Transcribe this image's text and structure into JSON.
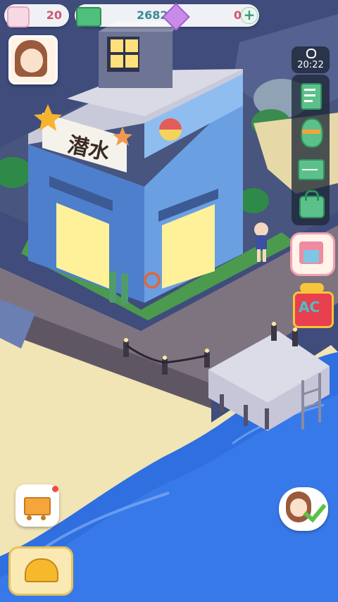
{
  "hud": {
    "gems_value": "20",
    "cash_value": "2682",
    "crystal_value": "0",
    "plus_symbol": "+",
    "clock_time": "20:22"
  },
  "building": {
    "sign_text": "潜水"
  },
  "side_menu": {
    "items": [
      "task-list",
      "easter-egg",
      "mail",
      "bag"
    ]
  },
  "action_buttons": {
    "shop_label": "",
    "ac_label": "AC"
  },
  "colors": {
    "sea": "#2f6fe0",
    "sand": "#f3e7b9",
    "grass": "#4b9a4e",
    "deck": "#8a7e86",
    "building_blue": "#5a8fd6",
    "window_glow": "#ffe878"
  }
}
